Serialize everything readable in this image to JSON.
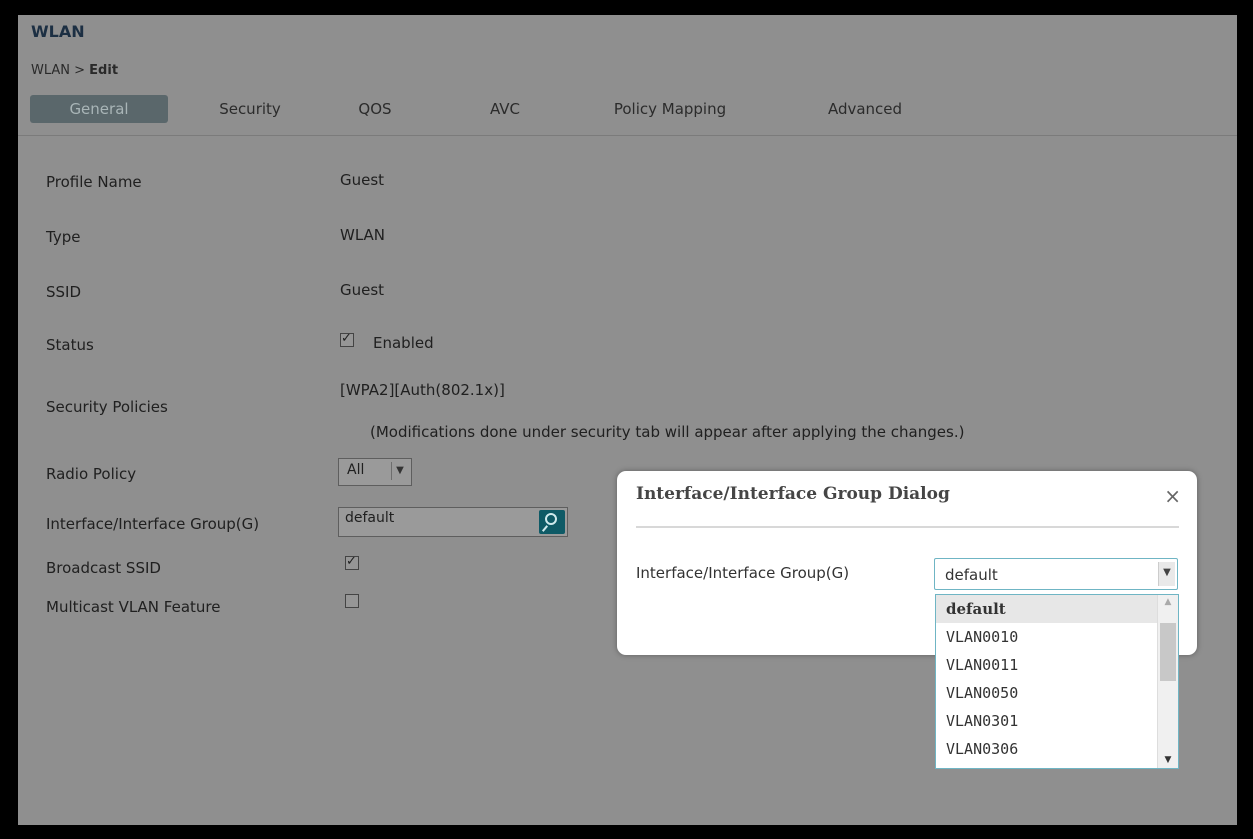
{
  "page": {
    "title": "WLAN",
    "breadcrumb_prefix": "WLAN > ",
    "breadcrumb_current": "Edit"
  },
  "tabs": [
    {
      "label": "General",
      "active": true
    },
    {
      "label": "Security"
    },
    {
      "label": "QOS"
    },
    {
      "label": "AVC"
    },
    {
      "label": "Policy Mapping"
    },
    {
      "label": "Advanced"
    }
  ],
  "form": {
    "profile_name": {
      "label": "Profile Name",
      "value": "Guest"
    },
    "type": {
      "label": "Type",
      "value": "WLAN"
    },
    "ssid": {
      "label": "SSID",
      "value": "Guest"
    },
    "status": {
      "label": "Status",
      "value": "Enabled",
      "checked": true
    },
    "security_policies": {
      "label": "Security Policies",
      "value": "[WPA2][Auth(802.1x)]",
      "note": "(Modifications done under security tab will appear after applying the changes.)"
    },
    "radio_policy": {
      "label": "Radio Policy",
      "value": "All"
    },
    "interface": {
      "label": "Interface/Interface Group(G)",
      "value": "default"
    },
    "broadcast_ssid": {
      "label": "Broadcast SSID",
      "checked": true
    },
    "multicast_vlan": {
      "label": "Multicast VLAN Feature",
      "checked": false
    }
  },
  "dialog": {
    "title": "Interface/Interface Group Dialog",
    "close_icon": "×",
    "field_label": "Interface/Interface Group(G)",
    "selected": "default",
    "options": [
      "default",
      "VLAN0010",
      "VLAN0011",
      "VLAN0050",
      "VLAN0301",
      "VLAN0306"
    ]
  },
  "icons": {
    "dropdown_arrow": "▼",
    "scroll_up": "▲",
    "scroll_down": "▼"
  }
}
